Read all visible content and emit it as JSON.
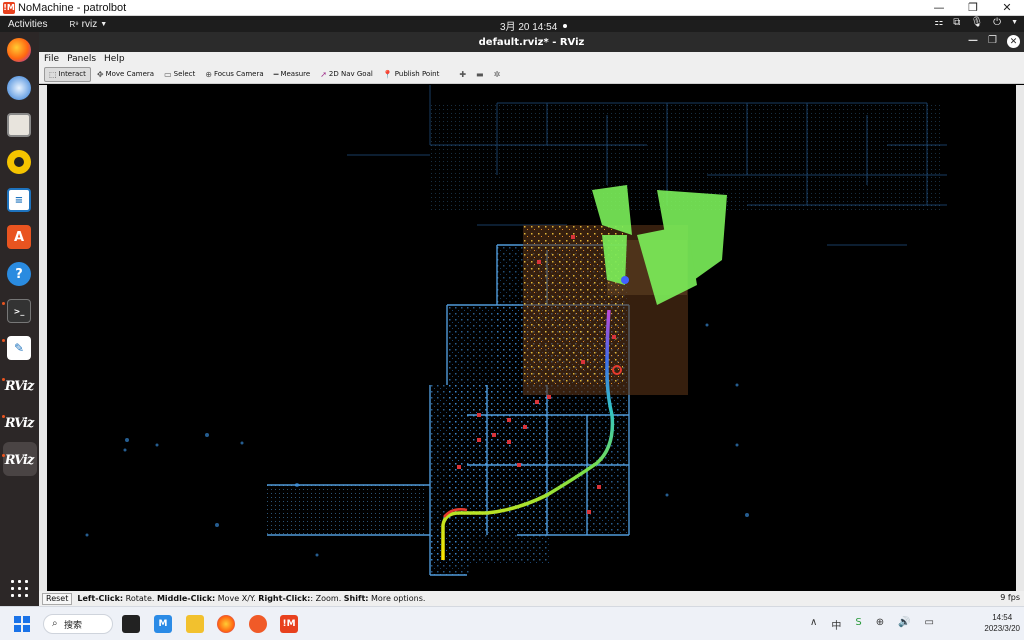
{
  "nomachine": {
    "title": "NoMachine - patrolbot",
    "logo": "!M",
    "controls": [
      "—",
      "❐",
      "✕"
    ]
  },
  "gnome": {
    "activities": "Activities",
    "app_name": "rviz",
    "clock": "3月 20  14:54"
  },
  "rviz": {
    "window_title": "default.rviz* - RViz",
    "menu": [
      "File",
      "Panels",
      "Help"
    ],
    "tools": [
      {
        "label": "Interact",
        "icon": "interact-icon"
      },
      {
        "label": "Move Camera",
        "icon": "move-camera-icon"
      },
      {
        "label": "Select",
        "icon": "select-icon"
      },
      {
        "label": "Focus Camera",
        "icon": "focus-camera-icon"
      },
      {
        "label": "Measure",
        "icon": "measure-icon"
      },
      {
        "label": "2D Nav Goal",
        "icon": "nav-goal-icon"
      },
      {
        "label": "Publish Point",
        "icon": "publish-point-icon"
      }
    ],
    "status": {
      "reset": "Reset",
      "left_click_key": "Left-Click:",
      "left_click_val": " Rotate. ",
      "middle_click_key": "Middle-Click:",
      "middle_click_val": " Move X/Y. ",
      "right_click_key": "Right-Click:",
      "right_click_val": ": Zoom. ",
      "shift_key": "Shift:",
      "shift_val": " More options.",
      "fps": "9 fps"
    }
  },
  "dock": {
    "items": [
      "firefox-icon",
      "thunderbird-icon",
      "files-icon",
      "rhythmbox-icon",
      "writer-icon",
      "app-center-icon",
      "help-icon",
      "terminal-icon",
      "text-editor-icon",
      "rviz-icon",
      "rviz-icon",
      "rviz-icon"
    ],
    "rviz_label": "RViz"
  },
  "taskbar": {
    "search_placeholder": "搜索",
    "time": "14:54",
    "date": "2023/3/20"
  },
  "colors": {
    "map_points": "#3fa3ff",
    "costmap": "#5a3418",
    "laser": "#7cf05a",
    "accent": "#e95420"
  }
}
